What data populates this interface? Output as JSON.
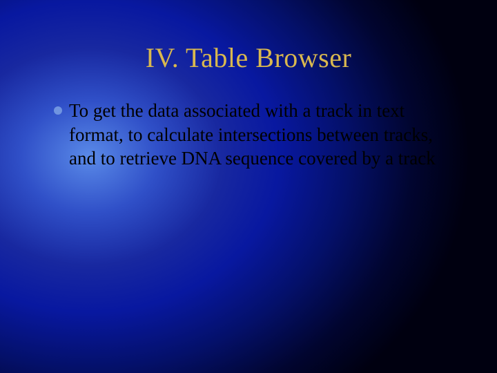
{
  "slide": {
    "title": "IV. Table Browser",
    "bullets": [
      {
        "text": "To get the data associated with a track in text format, to calculate intersections between tracks, and to retrieve DNA sequence covered by a track"
      }
    ]
  }
}
